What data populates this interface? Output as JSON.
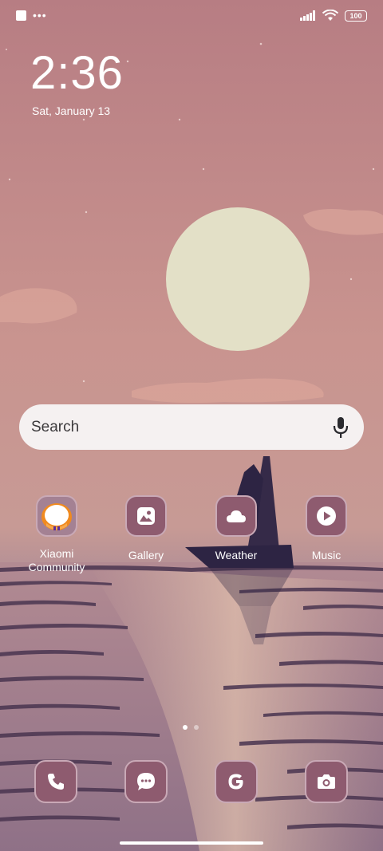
{
  "status_bar": {
    "battery": "100"
  },
  "lock": {
    "time": "2:36",
    "date": "Sat, January 13"
  },
  "search": {
    "placeholder": "Search"
  },
  "apps": [
    {
      "label": "Xiaomi\nCommunity",
      "icon": "xiaomi-community-icon"
    },
    {
      "label": "Gallery",
      "icon": "gallery-icon"
    },
    {
      "label": "Weather",
      "icon": "weather-icon"
    },
    {
      "label": "Music",
      "icon": "music-icon"
    }
  ],
  "dock": [
    {
      "icon": "phone-icon"
    },
    {
      "icon": "messages-icon"
    },
    {
      "icon": "google-icon"
    },
    {
      "icon": "camera-icon"
    }
  ],
  "pager": {
    "pages": 2,
    "current": 1
  },
  "colors": {
    "tile": "#8e5b6f",
    "tile_border": "#c9a9b6",
    "moon": "#e3e0c7",
    "boat": "#2d2443"
  }
}
